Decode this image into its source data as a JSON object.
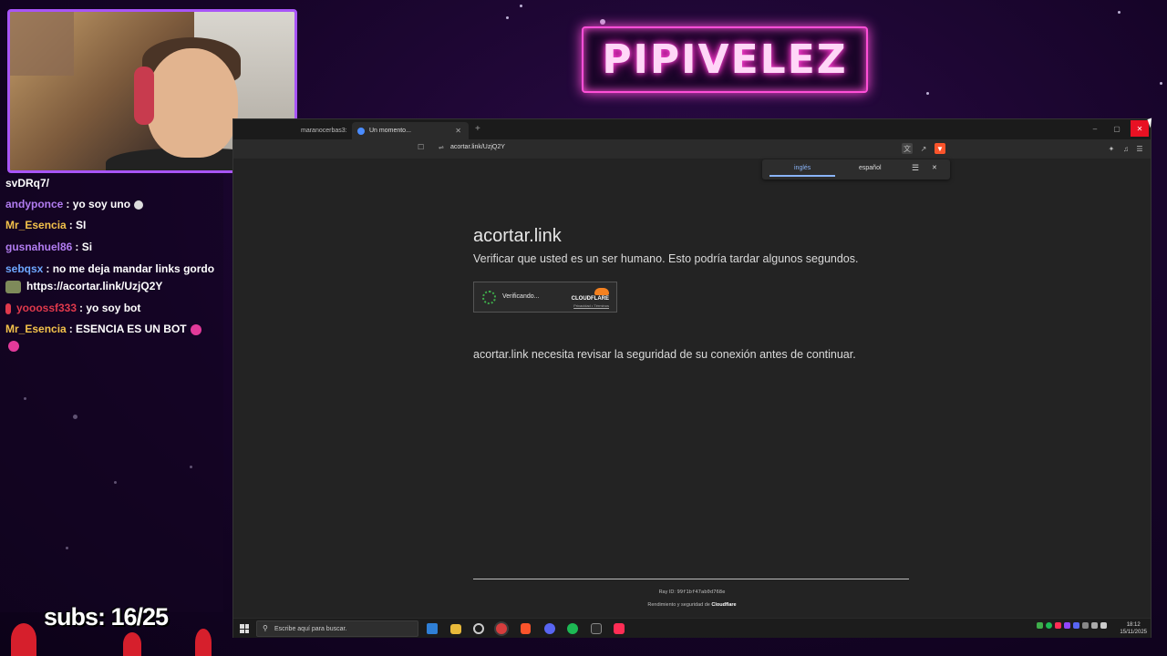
{
  "brand": {
    "title": "PIPIVELEZ"
  },
  "webcam": {
    "description": "streamer camera"
  },
  "chat": {
    "messages": [
      {
        "user": "",
        "text": "svDRq7/",
        "user_color": "#ffffff"
      },
      {
        "user": "andyponce",
        "text": ": yo soy uno",
        "user_color": "#b17cf0"
      },
      {
        "user": "Mr_Esencia",
        "text": ": SI",
        "user_color": "#f3c24b"
      },
      {
        "user": "gusnahuel86",
        "text": ": Si",
        "user_color": "#b17cf0"
      },
      {
        "user": "sebqsx",
        "text": ": no me deja mandar links gordo",
        "user_color": "#6ea8ff"
      },
      {
        "user": "",
        "text": "https://acortar.link/UzjQ2Y",
        "user_color": "#ffffff"
      },
      {
        "user": "yooossf333",
        "text": ": yo soy bot",
        "user_color": "#e0394c"
      },
      {
        "user": "Mr_Esencia",
        "text": ": ESENCIA ES UN BOT",
        "user_color": "#f3c24b"
      }
    ]
  },
  "subs": {
    "label": "subs: 16/25"
  },
  "browser": {
    "tabs": [
      {
        "label": "maranocerbas3:"
      },
      {
        "label": "Un momento..."
      }
    ],
    "new_tab": "+",
    "url": "acortar.link/UzjQ2Y",
    "window_controls": {
      "minimize": "–",
      "maximize": "▢",
      "close": "✕"
    },
    "translate": {
      "source": "inglés",
      "target": "español",
      "close": "✕"
    }
  },
  "page": {
    "title": "acortar.link",
    "subtitle": "Verificar que usted es un ser humano. Esto podría tardar algunos segundos.",
    "captcha_status": "Verificando...",
    "captcha_brand": "CLOUDFLARE",
    "captcha_links": "Privacidad • Términos",
    "security_message": "acortar.link necesita revisar la seguridad de su conexión antes de continuar.",
    "ray_label": "Ray ID:",
    "ray_id": "99f1bf47ab0d768e",
    "performance": "Rendimiento y seguridad de",
    "performance_brand": "Cloudflare"
  },
  "taskbar": {
    "search_placeholder": "Escribe aquí para buscar.",
    "time": "18:12",
    "date": "15/11/2025"
  },
  "colors": {
    "accent": "#a855f7",
    "neon": "#ff4fd8",
    "close": "#e81123",
    "cloudflare": "#f48120"
  }
}
